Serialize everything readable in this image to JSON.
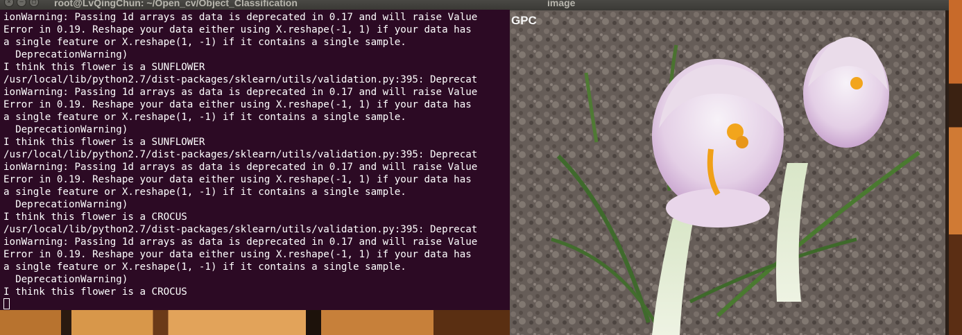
{
  "terminal": {
    "title": "root@LvQingChun: ~/Open_cv/Object_Classification",
    "lines": [
      "ionWarning: Passing 1d arrays as data is deprecated in 0.17 and will raise Value",
      "Error in 0.19. Reshape your data either using X.reshape(-1, 1) if your data has",
      "a single feature or X.reshape(1, -1) if it contains a single sample.",
      "  DeprecationWarning)",
      "I think this flower is a SUNFLOWER",
      "/usr/local/lib/python2.7/dist-packages/sklearn/utils/validation.py:395: Deprecat",
      "ionWarning: Passing 1d arrays as data is deprecated in 0.17 and will raise Value",
      "Error in 0.19. Reshape your data either using X.reshape(-1, 1) if your data has",
      "a single feature or X.reshape(1, -1) if it contains a single sample.",
      "  DeprecationWarning)",
      "I think this flower is a SUNFLOWER",
      "/usr/local/lib/python2.7/dist-packages/sklearn/utils/validation.py:395: Deprecat",
      "ionWarning: Passing 1d arrays as data is deprecated in 0.17 and will raise Value",
      "Error in 0.19. Reshape your data either using X.reshape(-1, 1) if your data has",
      "a single feature or X.reshape(1, -1) if it contains a single sample.",
      "  DeprecationWarning)",
      "I think this flower is a CROCUS",
      "/usr/local/lib/python2.7/dist-packages/sklearn/utils/validation.py:395: Deprecat",
      "ionWarning: Passing 1d arrays as data is deprecated in 0.17 and will raise Value",
      "Error in 0.19. Reshape your data either using X.reshape(-1, 1) if your data has",
      "a single feature or X.reshape(1, -1) if it contains a single sample.",
      "  DeprecationWarning)",
      "I think this flower is a CROCUS"
    ],
    "colors": {
      "background": "#2c0a24",
      "text": "#ffffff"
    }
  },
  "image_window": {
    "title": "image",
    "overlay_text": "GPC",
    "subject": "crocus-flower-photo"
  }
}
